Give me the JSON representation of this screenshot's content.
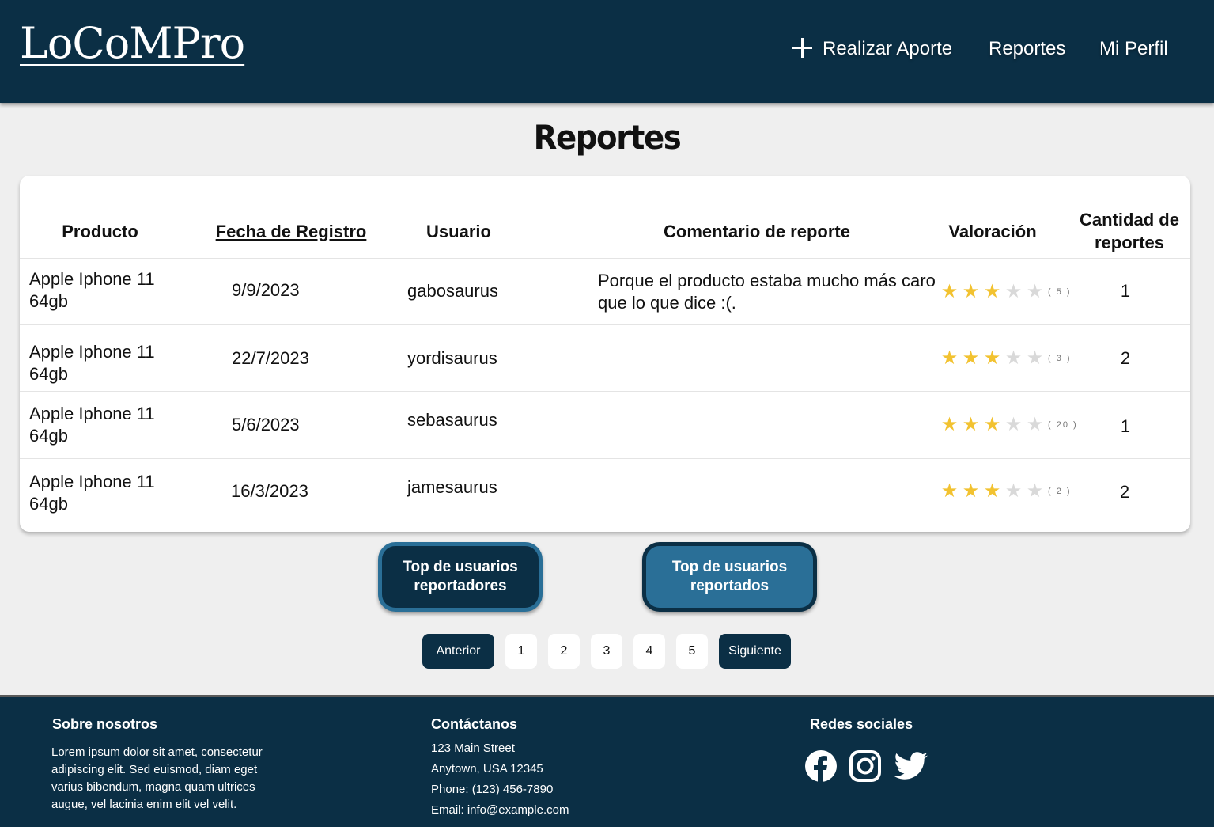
{
  "header": {
    "logo": "LoCoMPro",
    "nav": {
      "aporte": "Realizar Aporte",
      "reportes": "Reportes",
      "perfil": "Mi Perfil"
    }
  },
  "page_title": "Reportes",
  "table": {
    "headers": {
      "producto": "Producto",
      "fecha": "Fecha de Registro",
      "usuario": "Usuario",
      "comentario": "Comentario de reporte",
      "valoracion": "Valoración",
      "cantidad": "Cantidad de reportes"
    },
    "rows": [
      {
        "producto": "Apple Iphone 11 64gb",
        "fecha": "9/9/2023",
        "usuario": "gabosaurus",
        "comentario": "Porque el producto estaba mucho más caro que lo que dice :(.",
        "rating": 3,
        "rating_count": "( 5 )",
        "cantidad": "1"
      },
      {
        "producto": "Apple Iphone 11 64gb",
        "fecha": "22/7/2023",
        "usuario": "yordisaurus",
        "comentario": "",
        "rating": 3,
        "rating_count": "( 3 )",
        "cantidad": "2"
      },
      {
        "producto": "Apple Iphone 11 64gb",
        "fecha": "5/6/2023",
        "usuario": "sebasaurus",
        "comentario": "",
        "rating": 3,
        "rating_count": "( 20 )",
        "cantidad": "1"
      },
      {
        "producto": "Apple Iphone 11 64gb",
        "fecha": "16/3/2023",
        "usuario": "jamesaurus",
        "comentario": "",
        "rating": 3,
        "rating_count": "( 2 )",
        "cantidad": "2"
      }
    ]
  },
  "buttons": {
    "top_reportadores": "Top de usuarios reportadores",
    "top_reportados": "Top de usuarios reportados"
  },
  "pagination": {
    "prev": "Anterior",
    "pages": [
      "1",
      "2",
      "3",
      "4",
      "5"
    ],
    "next": "Siguiente"
  },
  "footer": {
    "about_title": "Sobre nosotros",
    "about_text": "Lorem ipsum dolor sit amet, consectetur adipiscing elit. Sed euismod, diam eget varius bibendum, magna quam ultrices augue, vel lacinia enim elit vel velit.",
    "contact_title": "Contáctanos",
    "contact_lines": [
      "123 Main Street",
      "Anytown, USA 12345",
      "Phone: (123) 456-7890",
      "Email: info@example.com"
    ],
    "social_title": "Redes sociales",
    "social_icons": [
      "facebook-icon",
      "instagram-icon",
      "twitter-icon"
    ]
  },
  "colors": {
    "primary": "#0b2f45",
    "accent": "#2a6f97",
    "background": "#efefef",
    "star_on": "#f2c230",
    "star_off": "#d9d9d9"
  }
}
